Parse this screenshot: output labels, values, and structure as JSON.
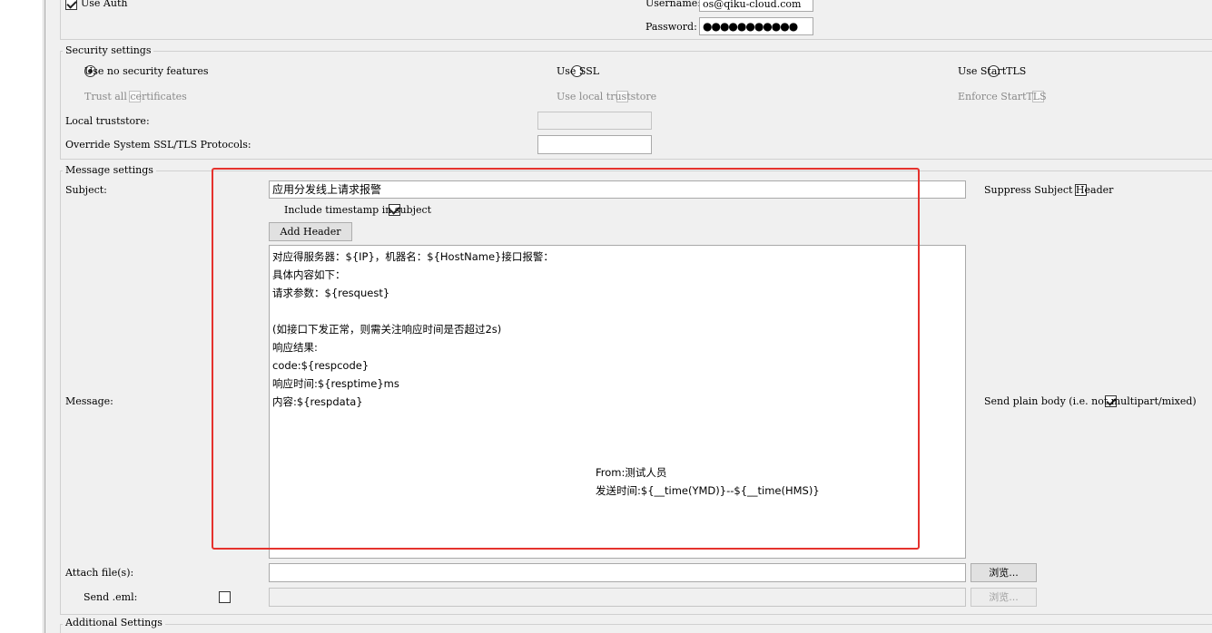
{
  "auth": {
    "use_auth_label": "Use Auth",
    "use_auth_checked": true,
    "username_label": "Username:",
    "username_value": "os@qiku-cloud.com",
    "password_label": "Password:",
    "password_mask": "●●●●●●●●●●●"
  },
  "security": {
    "title": "Security settings",
    "no_security_label": "Use no security features",
    "use_ssl_label": "Use SSL",
    "use_starttls_label": "Use StartTLS",
    "trust_all_label": "Trust all certificates",
    "use_local_truststore_label": "Use local truststore",
    "enforce_starttls_label": "Enforce StartTLS",
    "local_truststore_label": "Local truststore:",
    "local_truststore_value": "",
    "override_label": "Override System SSL/TLS Protocols:",
    "override_value": "",
    "selected": "no_security"
  },
  "message": {
    "title": "Message settings",
    "subject_label": "Subject:",
    "subject_value": "应用分发线上请求报警",
    "suppress_subject_label": "Suppress Subject Header",
    "suppress_subject_checked": false,
    "include_timestamp_label": "Include timestamp in subject",
    "include_timestamp_checked": true,
    "add_header_label": "Add Header",
    "message_label": "Message:",
    "body_lines": [
      "对应得服务器：${IP}，机器名：${HostName}接口报警：",
      "具体内容如下：",
      "请求参数：${resquest}",
      "",
      "(如接口下发正常，则需关注响应时间是否超过2s)",
      "响应结果:",
      "code:${respcode}",
      "响应时间:${resptime}ms",
      "内容:${respdata}"
    ],
    "footer_lines": [
      "From:测试人员",
      "发送时间:${__time(YMD)}--${__time(HMS)}"
    ],
    "send_plain_label": "Send plain body (i.e. not multipart/mixed)",
    "send_plain_checked": true,
    "attach_label": "Attach file(s):",
    "attach_value": "",
    "browse_label": "浏览...",
    "send_eml_label": "Send .eml:",
    "send_eml_checked": false,
    "send_eml_value": "",
    "browse_disabled_label": "浏览..."
  },
  "additional": {
    "title": "Additional Settings"
  },
  "colors": {
    "highlight_box": "#e5322d",
    "background": "#f0f0f0"
  }
}
